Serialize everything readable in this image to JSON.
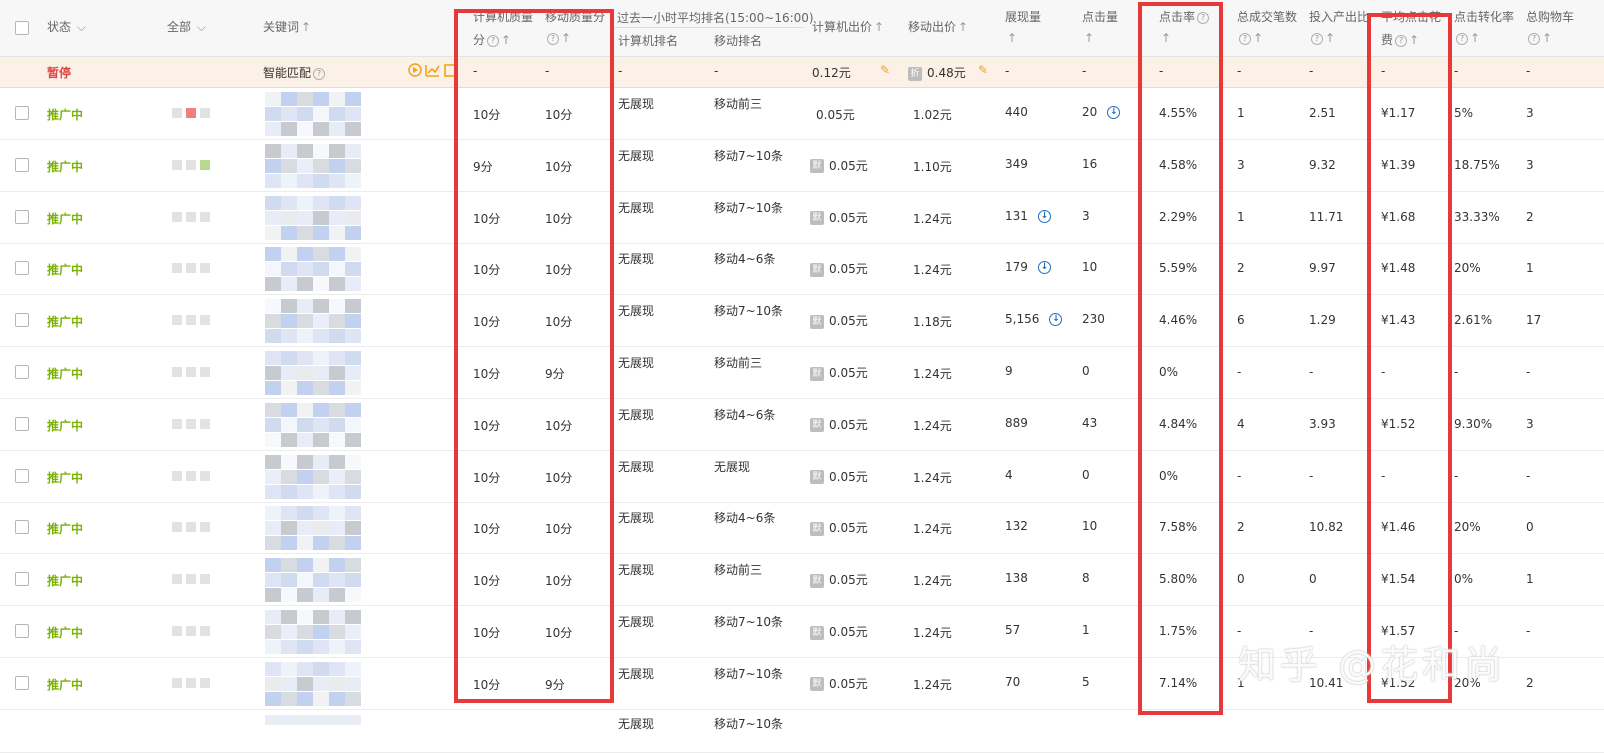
{
  "header": {
    "status": "状态",
    "filter_all": "全部",
    "keyword": "关键词",
    "pc_quality_line1": "计算机质量",
    "pc_quality_line2": "分",
    "mobile_quality": "移动质量分",
    "rank_group": "过去一小时平均排名(15:00~16:00)",
    "pc_rank": "计算机排名",
    "mobile_rank": "移动排名",
    "pc_bid": "计算机出价",
    "mobile_bid": "移动出价",
    "impressions": "展现量",
    "clicks": "点击量",
    "ctr": "点击率",
    "total_deals": "总成交笔数",
    "roi": "投入产出比",
    "avg_cpc_line1": "平均点击花",
    "avg_cpc_line2": "费",
    "conv_rate": "点击转化率",
    "total_cart": "总购物车"
  },
  "paused_row": {
    "status": "暂停",
    "keyword": "智能匹配",
    "pc_quality": "-",
    "mobile_quality": "-",
    "pc_rank": "-",
    "mobile_rank": "-",
    "pc_bid": "0.12元",
    "mobile_tag": "折",
    "mobile_bid": "0.48元",
    "impressions": "-",
    "clicks": "-",
    "ctr": "-",
    "total_deals": "-",
    "roi": "-",
    "avg_cpc": "-",
    "conv_rate": "-",
    "total_cart": "-"
  },
  "rows": [
    {
      "status": "推广中",
      "pcq": "10分",
      "mq": "10分",
      "pcr": "无展现",
      "mr": "移动前三",
      "pcb": "0.05元",
      "tag": false,
      "mb": "1.02元",
      "imp": "440",
      "clk": "20",
      "clk_dl": true,
      "imp_dl": false,
      "ctr": "4.55%",
      "deals": "1",
      "roi": "2.51",
      "cpc": "¥1.17",
      "conv": "5%",
      "cart": "3"
    },
    {
      "status": "推广中",
      "pcq": "9分",
      "mq": "10分",
      "pcr": "无展现",
      "mr": "移动7~10条",
      "pcb": "0.05元",
      "tag": true,
      "mb": "1.10元",
      "imp": "349",
      "clk": "16",
      "clk_dl": false,
      "imp_dl": false,
      "ctr": "4.58%",
      "deals": "3",
      "roi": "9.32",
      "cpc": "¥1.39",
      "conv": "18.75%",
      "cart": "3"
    },
    {
      "status": "推广中",
      "pcq": "10分",
      "mq": "10分",
      "pcr": "无展现",
      "mr": "移动7~10条",
      "pcb": "0.05元",
      "tag": true,
      "mb": "1.24元",
      "imp": "131",
      "clk": "3",
      "clk_dl": false,
      "imp_dl": true,
      "ctr": "2.29%",
      "deals": "1",
      "roi": "11.71",
      "cpc": "¥1.68",
      "conv": "33.33%",
      "cart": "2"
    },
    {
      "status": "推广中",
      "pcq": "10分",
      "mq": "10分",
      "pcr": "无展现",
      "mr": "移动4~6条",
      "pcb": "0.05元",
      "tag": true,
      "mb": "1.24元",
      "imp": "179",
      "clk": "10",
      "clk_dl": false,
      "imp_dl": true,
      "ctr": "5.59%",
      "deals": "2",
      "roi": "9.97",
      "cpc": "¥1.48",
      "conv": "20%",
      "cart": "1"
    },
    {
      "status": "推广中",
      "pcq": "10分",
      "mq": "10分",
      "pcr": "无展现",
      "mr": "移动7~10条",
      "pcb": "0.05元",
      "tag": true,
      "mb": "1.18元",
      "imp": "5,156",
      "clk": "230",
      "clk_dl": false,
      "imp_dl": true,
      "ctr": "4.46%",
      "deals": "6",
      "roi": "1.29",
      "cpc": "¥1.43",
      "conv": "2.61%",
      "cart": "17"
    },
    {
      "status": "推广中",
      "pcq": "10分",
      "mq": "9分",
      "pcr": "无展现",
      "mr": "移动前三",
      "pcb": "0.05元",
      "tag": true,
      "mb": "1.24元",
      "imp": "9",
      "clk": "0",
      "clk_dl": false,
      "imp_dl": false,
      "ctr": "0%",
      "deals": "-",
      "roi": "-",
      "cpc": "-",
      "conv": "-",
      "cart": "-"
    },
    {
      "status": "推广中",
      "pcq": "10分",
      "mq": "10分",
      "pcr": "无展现",
      "mr": "移动4~6条",
      "pcb": "0.05元",
      "tag": true,
      "mb": "1.24元",
      "imp": "889",
      "clk": "43",
      "clk_dl": false,
      "imp_dl": false,
      "ctr": "4.84%",
      "deals": "4",
      "roi": "3.93",
      "cpc": "¥1.52",
      "conv": "9.30%",
      "cart": "3"
    },
    {
      "status": "推广中",
      "pcq": "10分",
      "mq": "10分",
      "pcr": "无展现",
      "mr": "无展现",
      "pcb": "0.05元",
      "tag": true,
      "mb": "1.24元",
      "imp": "4",
      "clk": "0",
      "clk_dl": false,
      "imp_dl": false,
      "ctr": "0%",
      "deals": "-",
      "roi": "-",
      "cpc": "-",
      "conv": "-",
      "cart": "-"
    },
    {
      "status": "推广中",
      "pcq": "10分",
      "mq": "10分",
      "pcr": "无展现",
      "mr": "移动4~6条",
      "pcb": "0.05元",
      "tag": true,
      "mb": "1.24元",
      "imp": "132",
      "clk": "10",
      "clk_dl": false,
      "imp_dl": false,
      "ctr": "7.58%",
      "deals": "2",
      "roi": "10.82",
      "cpc": "¥1.46",
      "conv": "20%",
      "cart": "0"
    },
    {
      "status": "推广中",
      "pcq": "10分",
      "mq": "10分",
      "pcr": "无展现",
      "mr": "移动前三",
      "pcb": "0.05元",
      "tag": true,
      "mb": "1.24元",
      "imp": "138",
      "clk": "8",
      "clk_dl": false,
      "imp_dl": false,
      "ctr": "5.80%",
      "deals": "0",
      "roi": "0",
      "cpc": "¥1.54",
      "conv": "0%",
      "cart": "1"
    },
    {
      "status": "推广中",
      "pcq": "10分",
      "mq": "10分",
      "pcr": "无展现",
      "mr": "移动7~10条",
      "pcb": "0.05元",
      "tag": true,
      "mb": "1.24元",
      "imp": "57",
      "clk": "1",
      "clk_dl": false,
      "imp_dl": false,
      "ctr": "1.75%",
      "deals": "-",
      "roi": "-",
      "cpc": "¥1.57",
      "conv": "-",
      "cart": "-"
    },
    {
      "status": "推广中",
      "pcq": "10分",
      "mq": "9分",
      "pcr": "无展现",
      "mr": "移动7~10条",
      "pcb": "0.05元",
      "tag": true,
      "mb": "1.24元",
      "imp": "70",
      "clk": "5",
      "clk_dl": false,
      "imp_dl": false,
      "ctr": "7.14%",
      "deals": "1",
      "roi": "10.41",
      "cpc": "¥1.52",
      "conv": "20%",
      "cart": "2"
    }
  ],
  "partial_row": {
    "pcr": "无展现",
    "mr": "移动7~10条"
  },
  "icons": {
    "help": "?",
    "sort": "↑",
    "dropdown": "⌵",
    "pencil": "✎",
    "download": "↓",
    "mobile_price_tag": "默"
  },
  "watermark": "知乎 @花和尚",
  "colors": {
    "active_status": "#7cb305",
    "paused_status": "#e04747",
    "highlight_box": "#e8393a",
    "download_icon": "#1f6fbe"
  }
}
